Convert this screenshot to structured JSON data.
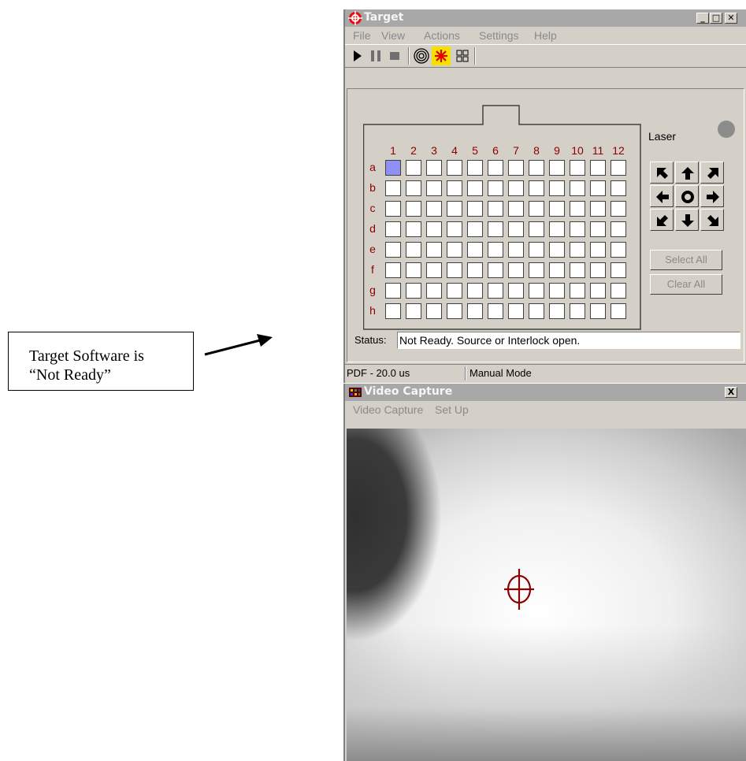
{
  "callout": {
    "line1": "Target Software is",
    "line2": "“Not Ready”"
  },
  "target_window": {
    "title": "Target",
    "menu": [
      "File",
      "View",
      "Actions",
      "Settings",
      "Help"
    ],
    "toolbar_icons": [
      "play-icon",
      "pause-icon",
      "stop-icon",
      "target-rings-icon",
      "laser-star-icon",
      "grid-view-icon"
    ],
    "columns": [
      "1",
      "2",
      "3",
      "4",
      "5",
      "6",
      "7",
      "8",
      "9",
      "10",
      "11",
      "12"
    ],
    "rows": [
      "a",
      "b",
      "c",
      "d",
      "e",
      "f",
      "g",
      "h"
    ],
    "selected_well": "a1",
    "laser_label": "Laser",
    "select_all_label": "Select All",
    "clear_all_label": "Clear All",
    "status_label": "Status:",
    "status_text": "Not Ready. Source or Interlock open.",
    "pdf_label": "PDF - 20.0 us",
    "mode_label": "Manual Mode",
    "colors": {
      "well_selected": "#8f8ff5",
      "label_red": "#8b0000",
      "laser_led": "#8c8c8c"
    }
  },
  "video_window": {
    "title": "Video Capture",
    "menu": [
      "Video Capture",
      "Set Up"
    ],
    "close_glyph": "X"
  }
}
